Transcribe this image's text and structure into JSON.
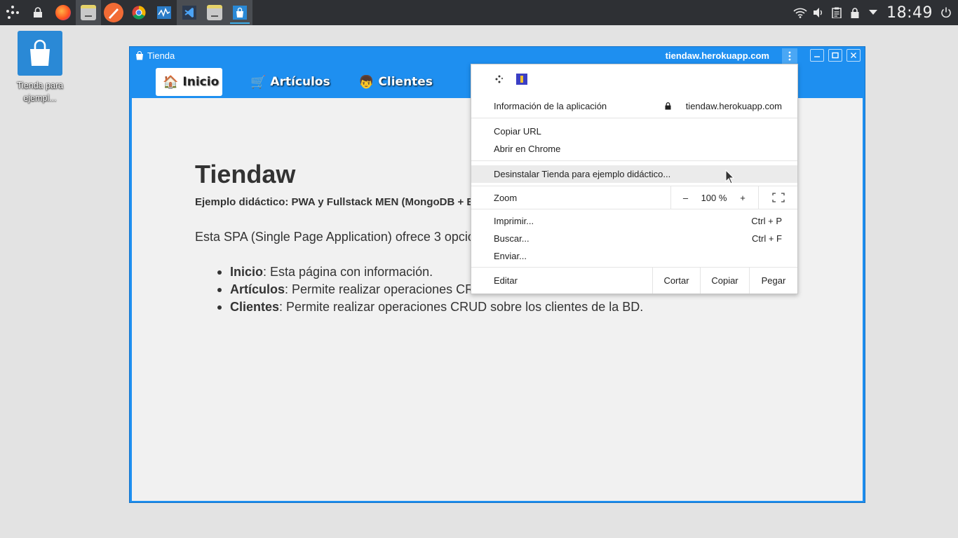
{
  "taskbar": {
    "clock": "18:49",
    "apps": [
      "launcher-icon",
      "lock-screen-icon",
      "firefox-icon",
      "file-manager-icon",
      "sketch-app-icon",
      "chrome-icon",
      "system-monitor-icon",
      "vscode-icon",
      "archive-manager-icon",
      "tienda-app-icon"
    ]
  },
  "desktop": {
    "icon_label": "Tienda para ejempl..."
  },
  "window": {
    "title": "Tienda",
    "url": "tiendaw.herokuapp.com",
    "accent": "#1e8ff0"
  },
  "nav": {
    "items": [
      {
        "label": "Inicio",
        "icon": "house-icon"
      },
      {
        "label": "Artículos",
        "icon": "cart-icon"
      },
      {
        "label": "Clientes",
        "icon": "person-icon"
      }
    ]
  },
  "page": {
    "title": "Tiendaw",
    "subtitle": "Ejemplo didáctico: PWA y Fullstack MEN (MongoDB + E",
    "intro": "Esta SPA (Single Page Application) ofrece 3 opcio",
    "options": [
      {
        "name": "Inicio",
        "text": ": Esta página con información."
      },
      {
        "name": "Artículos",
        "text": ": Permite realizar operaciones CR"
      },
      {
        "name": "Clientes",
        "text": ": Permite realizar operaciones CRUD sobre los clientes de la BD."
      }
    ]
  },
  "menu": {
    "app_info": "Información de la aplicación",
    "app_info_url": "tiendaw.herokuapp.com",
    "copy_url": "Copiar URL",
    "open_chrome": "Abrir en Chrome",
    "uninstall": "Desinstalar Tienda para ejemplo didáctico...",
    "zoom": "Zoom",
    "zoom_minus": "–",
    "zoom_value": "100 %",
    "zoom_plus": "+",
    "print": "Imprimir...",
    "print_shortcut": "Ctrl + P",
    "find": "Buscar...",
    "find_shortcut": "Ctrl + F",
    "send": "Enviar...",
    "edit": "Editar",
    "cut": "Cortar",
    "copy": "Copiar",
    "paste": "Pegar"
  }
}
